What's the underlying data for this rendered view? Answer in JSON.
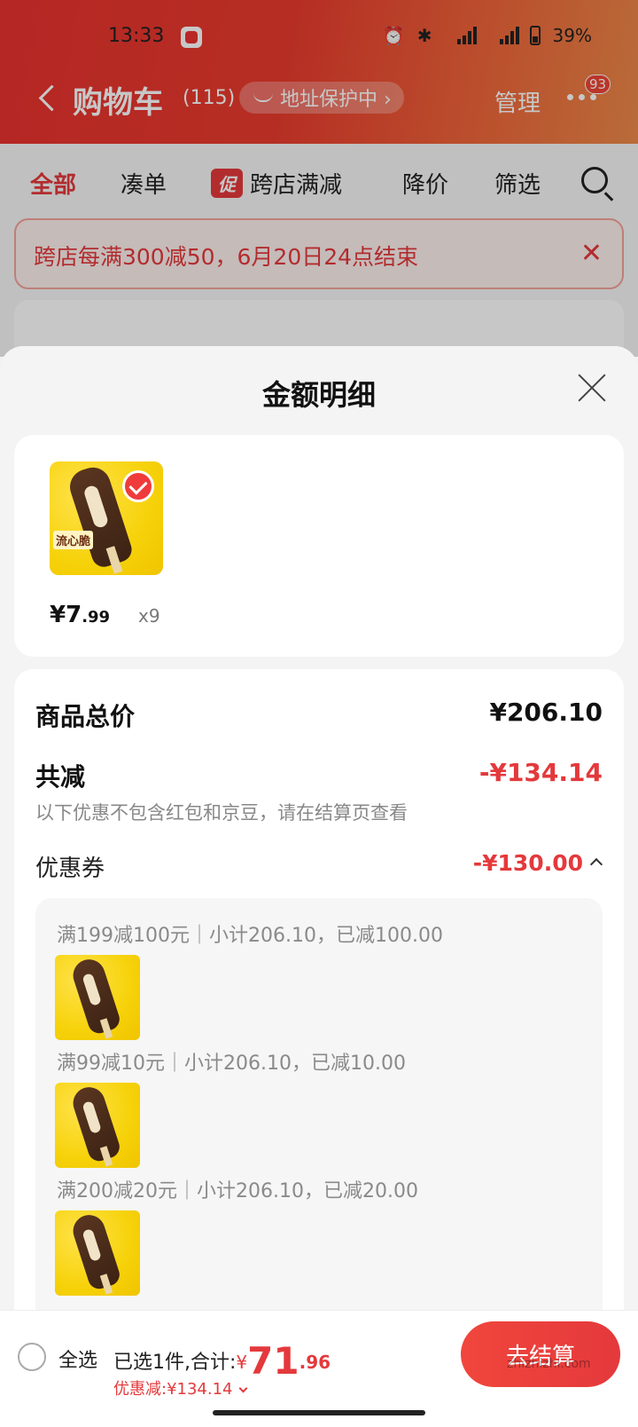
{
  "status": {
    "time": "13:33",
    "battery": "39%"
  },
  "header": {
    "title": "购物车",
    "count": "(115)",
    "address_pill": "地址保护中 ›",
    "manage": "管理",
    "msg_badge": "93"
  },
  "tabs": [
    {
      "label": "全部"
    },
    {
      "label": "凑单"
    },
    {
      "label": "跨店满减",
      "tag": "促"
    },
    {
      "label": "降价"
    },
    {
      "label": "筛选"
    }
  ],
  "banner": {
    "text": "跨店每满300减50，6月20日24点结束",
    "close": "✕"
  },
  "sheet": {
    "title": "金额明细",
    "product": {
      "price_int": "¥7",
      "price_dec": ".99",
      "qty": "x9",
      "brand": "流心脆"
    },
    "total_label": "商品总价",
    "total_value": "¥206.10",
    "reduce_label": "共减",
    "reduce_value": "-¥134.14",
    "hint": "以下优惠不包含红包和京豆，请在结算页查看",
    "coupon_label": "优惠券",
    "coupon_value": "-¥130.00",
    "rules": [
      "满199减100元｜小计206.10，已减100.00",
      "满99减10元｜小计206.10，已减10.00",
      "满200减20元｜小计206.10，已减20.00"
    ]
  },
  "bottom": {
    "select_all": "全选",
    "selected_prefix": "已选1件,合计:",
    "total_yen": "¥",
    "total_int": "71",
    "total_dec": ".96",
    "discount": "优惠减:¥134.14",
    "checkout": "去结算",
    "watermark": "zhizhizhi.com"
  },
  "colors": {
    "accent": "#e4393c",
    "header_start": "#e8322f",
    "header_end": "#ee8a4a"
  }
}
